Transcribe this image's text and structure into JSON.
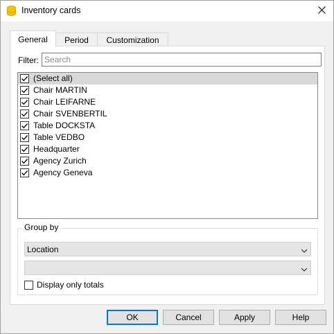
{
  "window": {
    "title": "Inventory cards",
    "app_icon": "database-icon",
    "close_icon": "close-icon"
  },
  "tabs": [
    {
      "label": "General",
      "active": true
    },
    {
      "label": "Period",
      "active": false
    },
    {
      "label": "Customization",
      "active": false
    }
  ],
  "filter": {
    "label": "Filter:",
    "value": "",
    "placeholder": "Search"
  },
  "items": [
    {
      "label": "(Select all)",
      "checked": true,
      "selected": true
    },
    {
      "label": "Chair MARTIN",
      "checked": true,
      "selected": false
    },
    {
      "label": "Chair LEIFARNE",
      "checked": true,
      "selected": false
    },
    {
      "label": "Chair SVENBERTIL",
      "checked": true,
      "selected": false
    },
    {
      "label": "Table DOCKSTA",
      "checked": true,
      "selected": false
    },
    {
      "label": "Table VEDBO",
      "checked": true,
      "selected": false
    },
    {
      "label": "Headquarter",
      "checked": true,
      "selected": false
    },
    {
      "label": "Agency Zurich",
      "checked": true,
      "selected": false
    },
    {
      "label": "Agency Geneva",
      "checked": true,
      "selected": false
    }
  ],
  "group_by": {
    "title": "Group by",
    "primary_value": "Location",
    "secondary_value": "",
    "totals_label": "Display only totals",
    "totals_checked": false
  },
  "buttons": {
    "ok": "OK",
    "cancel": "Cancel",
    "apply": "Apply",
    "help": "Help"
  },
  "colors": {
    "accent": "#0078d7",
    "icon_yellow": "#f5c400"
  }
}
